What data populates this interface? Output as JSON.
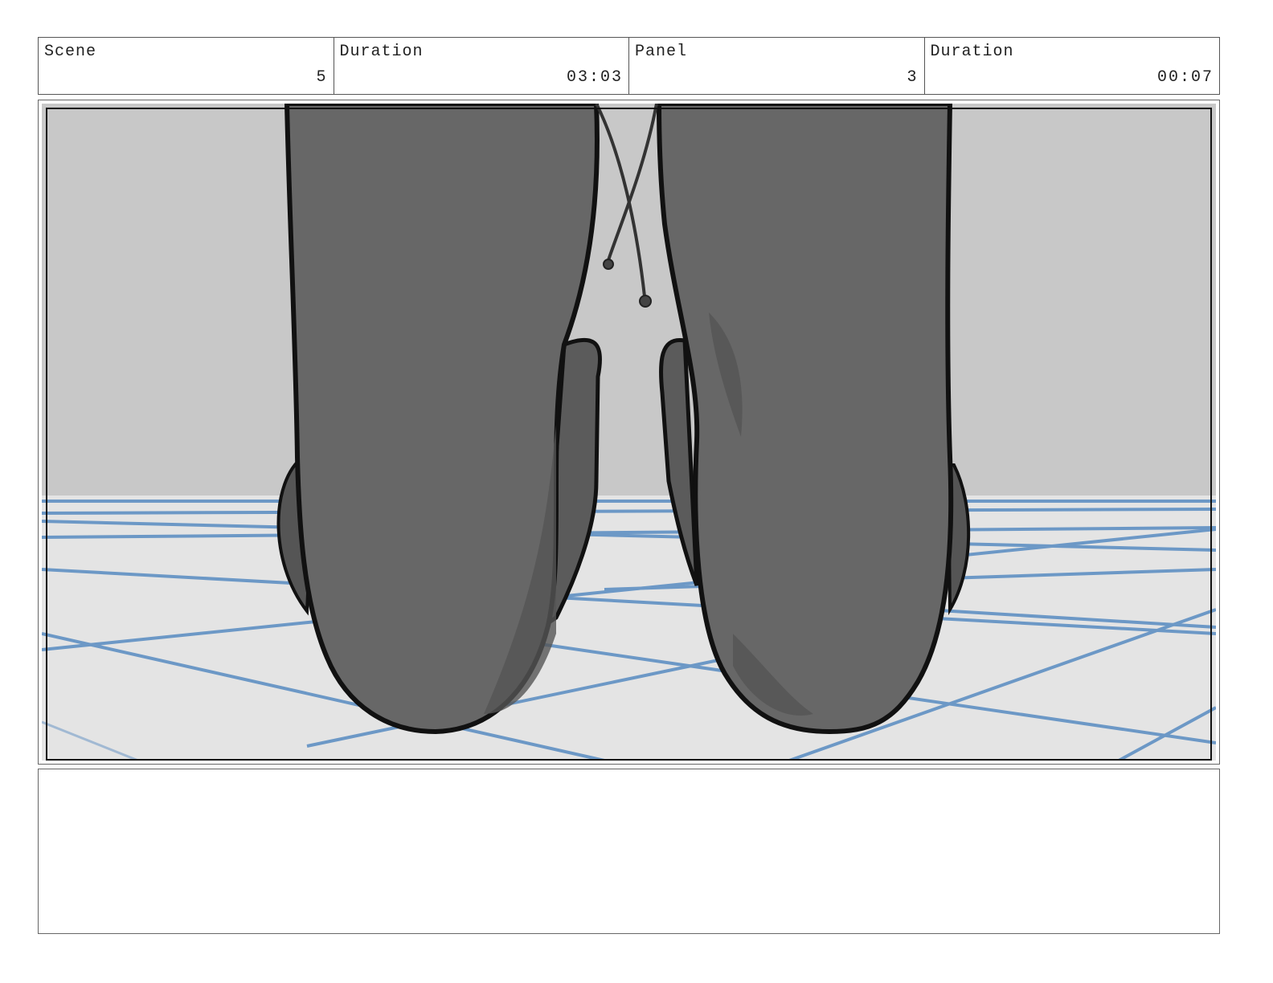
{
  "header": {
    "scene": {
      "label": "Scene",
      "value": "5"
    },
    "scene_duration": {
      "label": "Duration",
      "value": "03:03"
    },
    "panel": {
      "label": "Panel",
      "value": "3"
    },
    "panel_duration": {
      "label": "Duration",
      "value": "00:07"
    }
  },
  "panel_image": {
    "subject": "storyboard-sketch-feet",
    "colors": {
      "wall": "#c8c8c8",
      "floor": "#e4e4e4",
      "body": "#676767",
      "shadow": "#4e4e4e",
      "outline": "#111111",
      "grid_lines": "#4f86bf"
    }
  },
  "notes": {
    "text": ""
  }
}
